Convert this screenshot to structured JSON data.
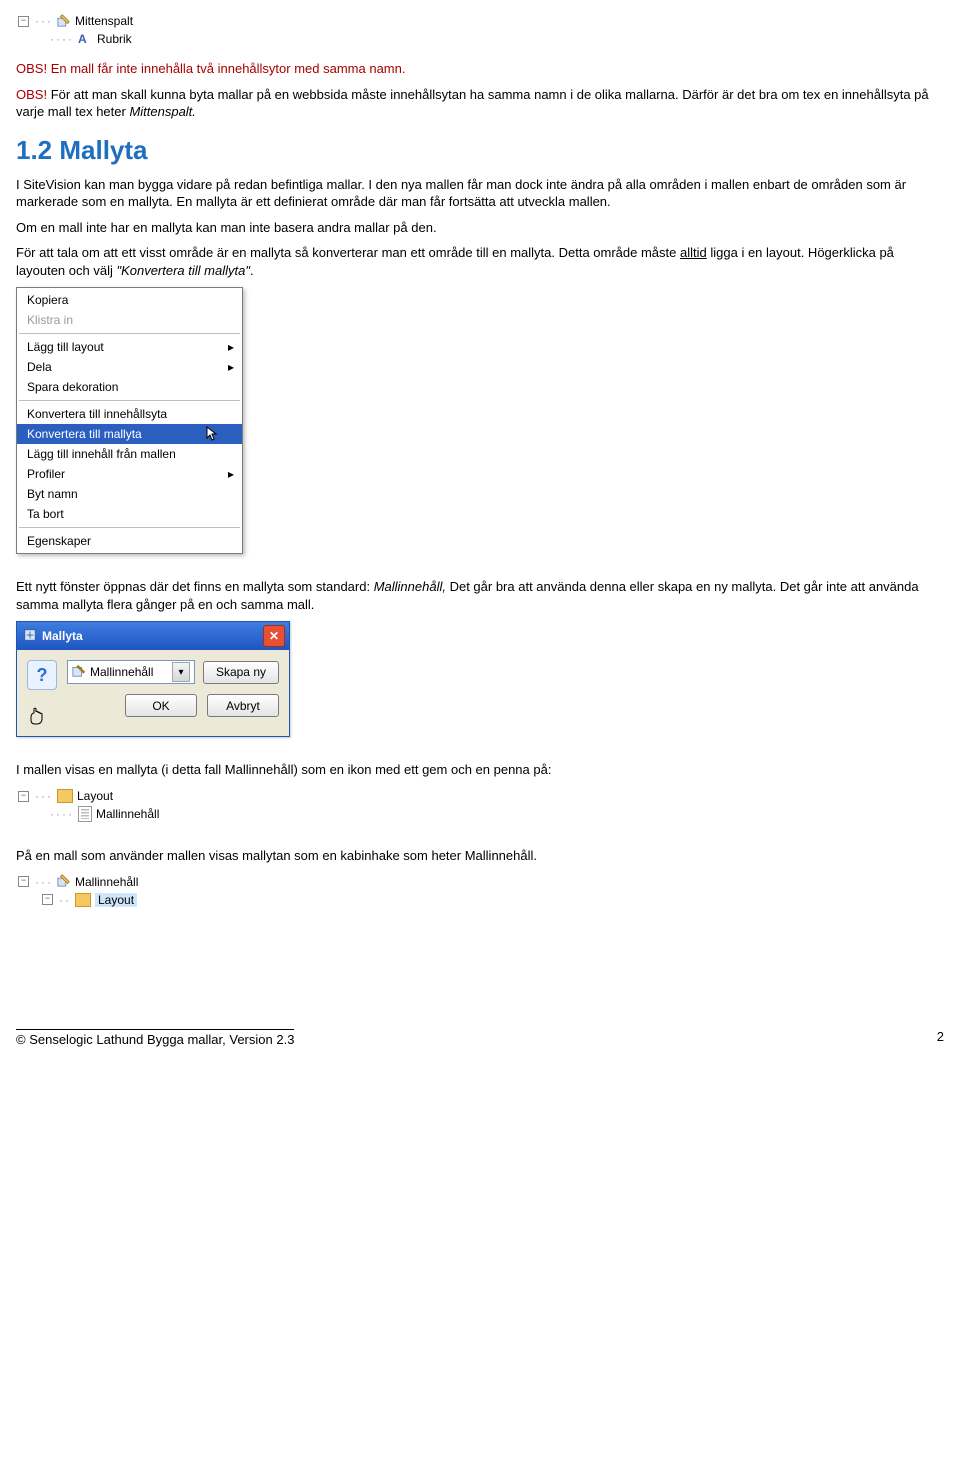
{
  "tree1": {
    "mittenspalt": "Mittenspalt",
    "rubrik": "Rubrik"
  },
  "obs1": {
    "label": "OBS!",
    "text": "  En mall får inte innehålla två innehållsytor med samma namn."
  },
  "obs2": {
    "label": "OBS!",
    "line1": " För att man skall kunna byta mallar på en webbsida måste innehållsytan ha samma namn i de olika mallarna. Därför är det bra om tex en innehållsyta på varje mall tex heter ",
    "italic": "Mittenspalt.",
    "after": ""
  },
  "heading": "1.2 Mallyta",
  "para1": "I SiteVision kan man bygga vidare på redan befintliga mallar. I den nya mallen får man dock inte ändra på alla områden i mallen enbart de områden som är markerade som en mallyta. En mallyta är ett definierat område där man får fortsätta att utveckla mallen.",
  "para2": "Om en mall inte har en mallyta kan man inte basera andra mallar på den.",
  "para3": {
    "a": "För att tala om att ett visst område är en mallyta så konverterar man ett område till en mallyta. Detta område måste ",
    "u": "alltid",
    "b": " ligga i en layout. Högerklicka på layouten och välj ",
    "i": "\"Konvertera till mallyta\"",
    "c": "."
  },
  "ctxmenu": {
    "kopiera": "Kopiera",
    "klistra": "Klistra in",
    "lagglayout": "Lägg till layout",
    "dela": "Dela",
    "spara": "Spara dekoration",
    "konvinnehall": "Konvertera till innehållsyta",
    "konvmallyta": "Konvertera till mallyta",
    "lagginnehall": "Lägg till innehåll från mallen",
    "profiler": "Profiler",
    "bytnamn": "Byt namn",
    "tabort": "Ta bort",
    "egenskaper": "Egenskaper"
  },
  "para4": {
    "a": "Ett nytt fönster öppnas där det finns en mallyta som standard: ",
    "i": "Mallinnehåll,",
    "b": " Det går bra att använda denna eller skapa en ny mallyta. Det går inte att använda samma mallyta flera gånger på en och samma mall."
  },
  "dialog": {
    "title": "Mallyta",
    "combo": "Mallinnehåll",
    "skapany": "Skapa ny",
    "ok": "OK",
    "avbryt": "Avbryt"
  },
  "para5": "I mallen visas en mallyta  (i detta fall Mallinnehåll) som en ikon med ett gem och en penna på:",
  "tree2": {
    "layout": "Layout",
    "mallinnehall": "Mallinnehåll"
  },
  "para6": "På en mall som använder mallen visas mallytan som en kabinhake som heter Mallinnehåll.",
  "tree3": {
    "mallinnehall": "Mallinnehåll",
    "layout": "Layout"
  },
  "footer": {
    "left": "© Senselogic Lathund Bygga mallar, Version 2.3",
    "right": "2"
  }
}
